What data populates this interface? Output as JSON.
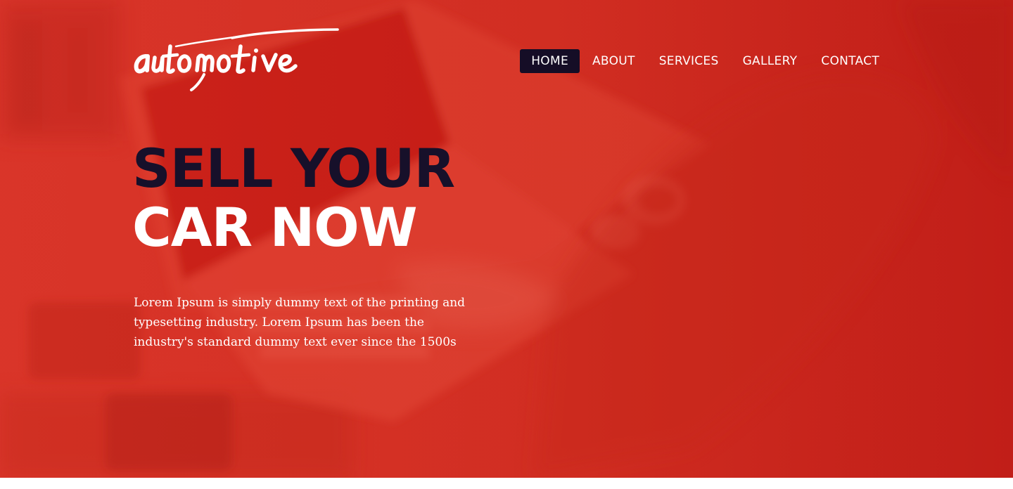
{
  "brand": {
    "logo_text": "automotive",
    "logo_icon": "brush-script-logo"
  },
  "nav": {
    "items": [
      {
        "label": "HOME",
        "active": true
      },
      {
        "label": "ABOUT",
        "active": false
      },
      {
        "label": "SERVICES",
        "active": false
      },
      {
        "label": "GALLERY",
        "active": false
      },
      {
        "label": "CONTACT",
        "active": false
      }
    ]
  },
  "hero": {
    "headline_line1": "SELL YOUR",
    "headline_line2": "CAR NOW",
    "description": "Lorem Ipsum is simply dummy text of the printing and typesetting industry. Lorem Ipsum has been the industry's standard dummy text ever since the 1500s"
  },
  "colors": {
    "hero_red": "#d42b1f",
    "navy": "#150d26",
    "white": "#ffffff"
  }
}
